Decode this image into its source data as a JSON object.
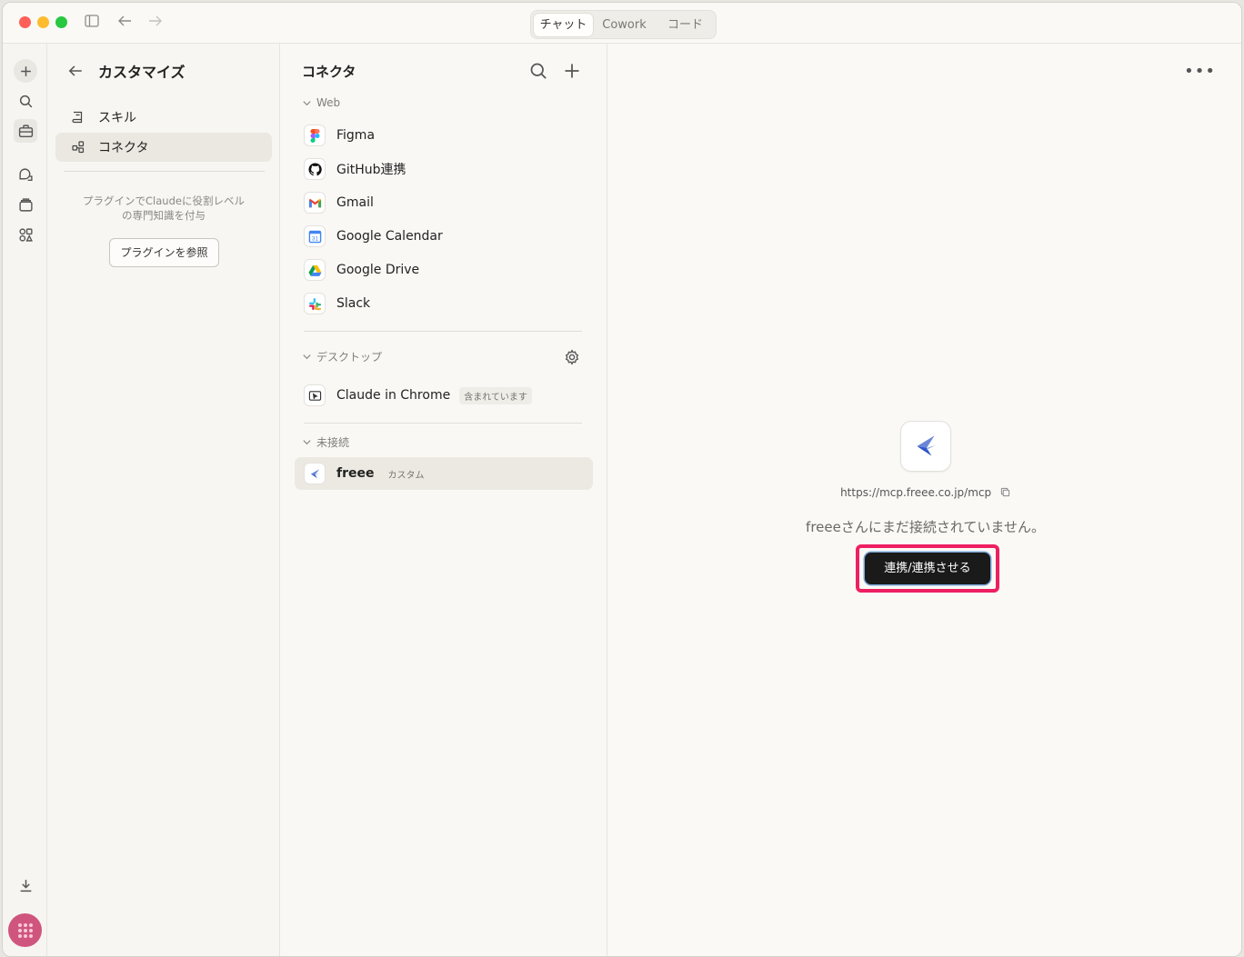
{
  "titlebar": {
    "tabs": [
      {
        "label": "チャット",
        "active": true
      },
      {
        "label": "Cowork",
        "active": false
      },
      {
        "label": "コード",
        "active": false
      }
    ]
  },
  "customize": {
    "title": "カスタマイズ",
    "items": [
      {
        "label": "スキル",
        "icon": "skill-icon",
        "active": false
      },
      {
        "label": "コネクタ",
        "icon": "connector-icon",
        "active": true
      }
    ],
    "description": "プラグインでClaudeに役割レベルの専門知識を付与",
    "browse_button": "プラグインを参照"
  },
  "connectors": {
    "title": "コネクタ",
    "sections": {
      "web": "Web",
      "desktop": "デスクトップ",
      "disconnected": "未接続"
    },
    "web_items": [
      {
        "label": "Figma",
        "icon": "figma-icon"
      },
      {
        "label": "GitHub連携",
        "icon": "github-icon"
      },
      {
        "label": "Gmail",
        "icon": "gmail-icon"
      },
      {
        "label": "Google Calendar",
        "icon": "google-calendar-icon"
      },
      {
        "label": "Google Drive",
        "icon": "google-drive-icon"
      },
      {
        "label": "Slack",
        "icon": "slack-icon"
      }
    ],
    "desktop_items": [
      {
        "label": "Claude in Chrome",
        "badge": "含まれています",
        "icon": "chrome-extension-icon"
      }
    ],
    "disconnected_items": [
      {
        "label": "freee",
        "badge": "カスタム",
        "icon": "freee-icon"
      }
    ]
  },
  "detail": {
    "url": "https://mcp.freee.co.jp/mcp",
    "message": "freeeさんにまだ接続されていません。",
    "connect_button": "連携/連携させる",
    "accent": "#ee1f62"
  }
}
